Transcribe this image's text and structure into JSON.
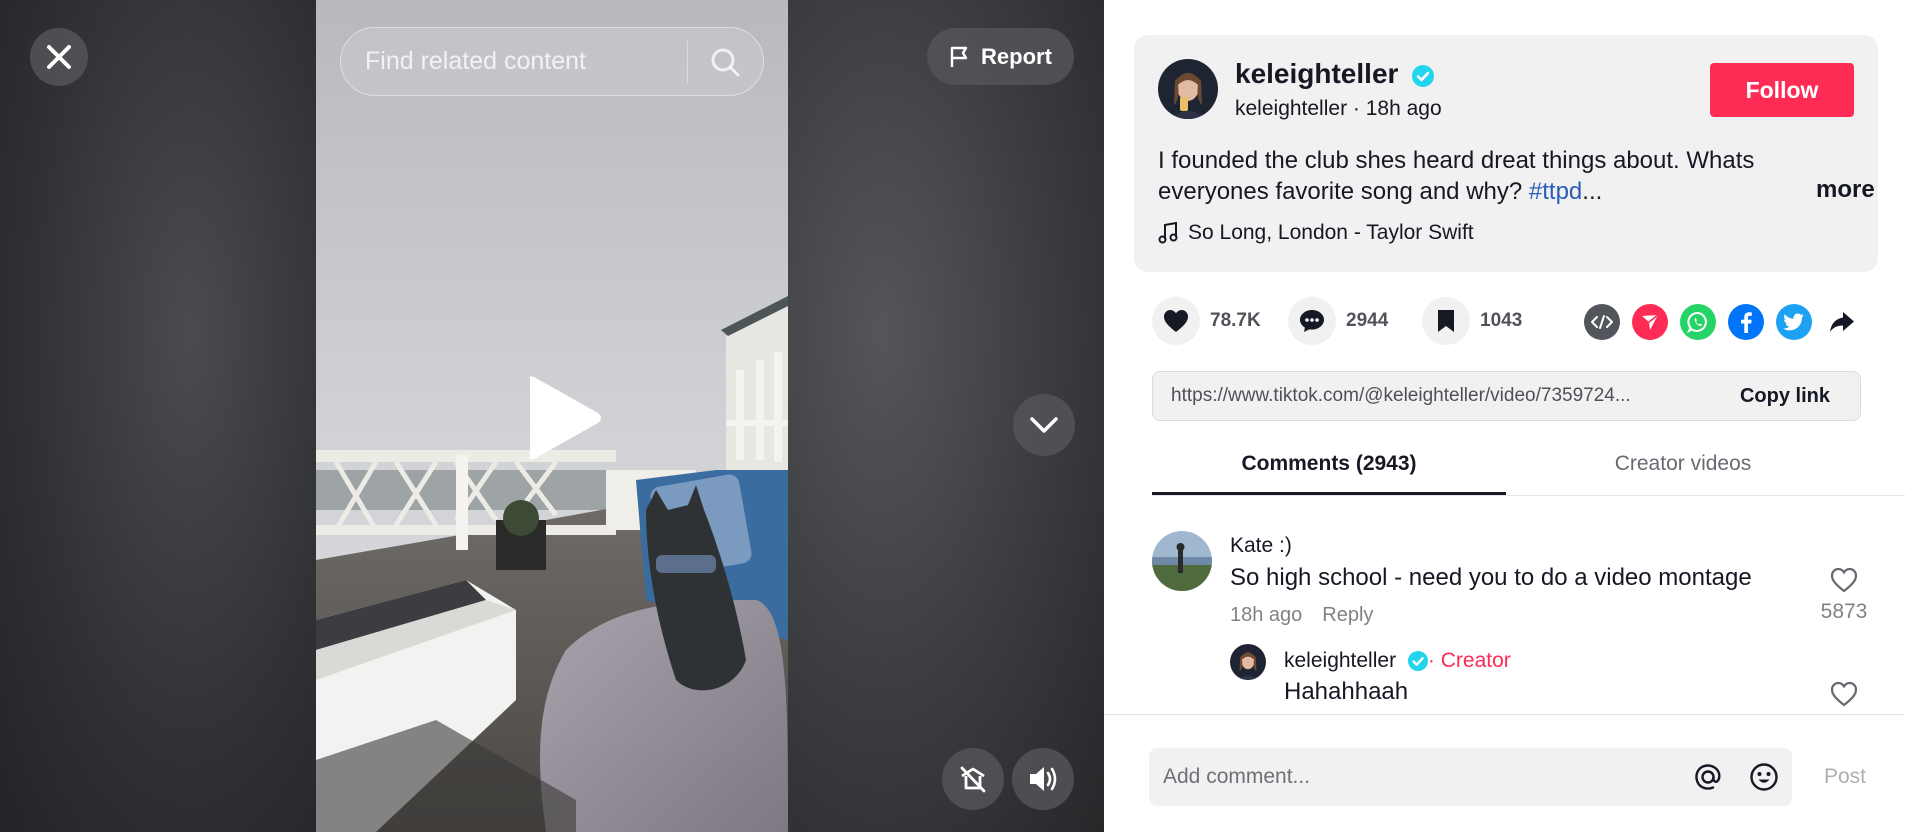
{
  "video": {
    "search_placeholder": "Find related content",
    "report_label": "Report"
  },
  "author": {
    "display_name": "keleighteller",
    "username": "keleighteller",
    "time_ago": "18h ago",
    "verified": true,
    "follow_label": "Follow"
  },
  "description": {
    "text": "I founded the club shes heard dreat things about. Whats everyones favorite song and why?",
    "hashtag": "#ttpd",
    "ellipsis": "...",
    "more_label": "more"
  },
  "music": {
    "title": "So Long, London - Taylor Swift"
  },
  "stats": {
    "likes": "78.7K",
    "comments": "2944",
    "saves": "1043"
  },
  "share_icons": [
    "embed-icon",
    "send-icon",
    "whatsapp-icon",
    "facebook-icon",
    "twitter-icon",
    "share-arrow-icon"
  ],
  "link": {
    "url": "https://www.tiktok.com/@keleighteller/video/7359724...",
    "copy_label": "Copy link"
  },
  "tabs": [
    {
      "label": "Comments (2943)",
      "active": true
    },
    {
      "label": "Creator videos",
      "active": false
    }
  ],
  "comments": [
    {
      "user": "Kate :)",
      "text": "So high school - need you to do a video montage",
      "time": "18h ago",
      "reply_label": "Reply",
      "likes": "5873"
    }
  ],
  "replies": [
    {
      "user": "keleighteller",
      "tag_sep": "·",
      "tag": "Creator",
      "text": "Hahahhaah"
    }
  ],
  "comment_box": {
    "placeholder": "Add comment...",
    "post_label": "Post"
  },
  "colors": {
    "accent": "#fe2c55",
    "verified": "#20d5ec",
    "hashtag": "#2b5db9"
  }
}
